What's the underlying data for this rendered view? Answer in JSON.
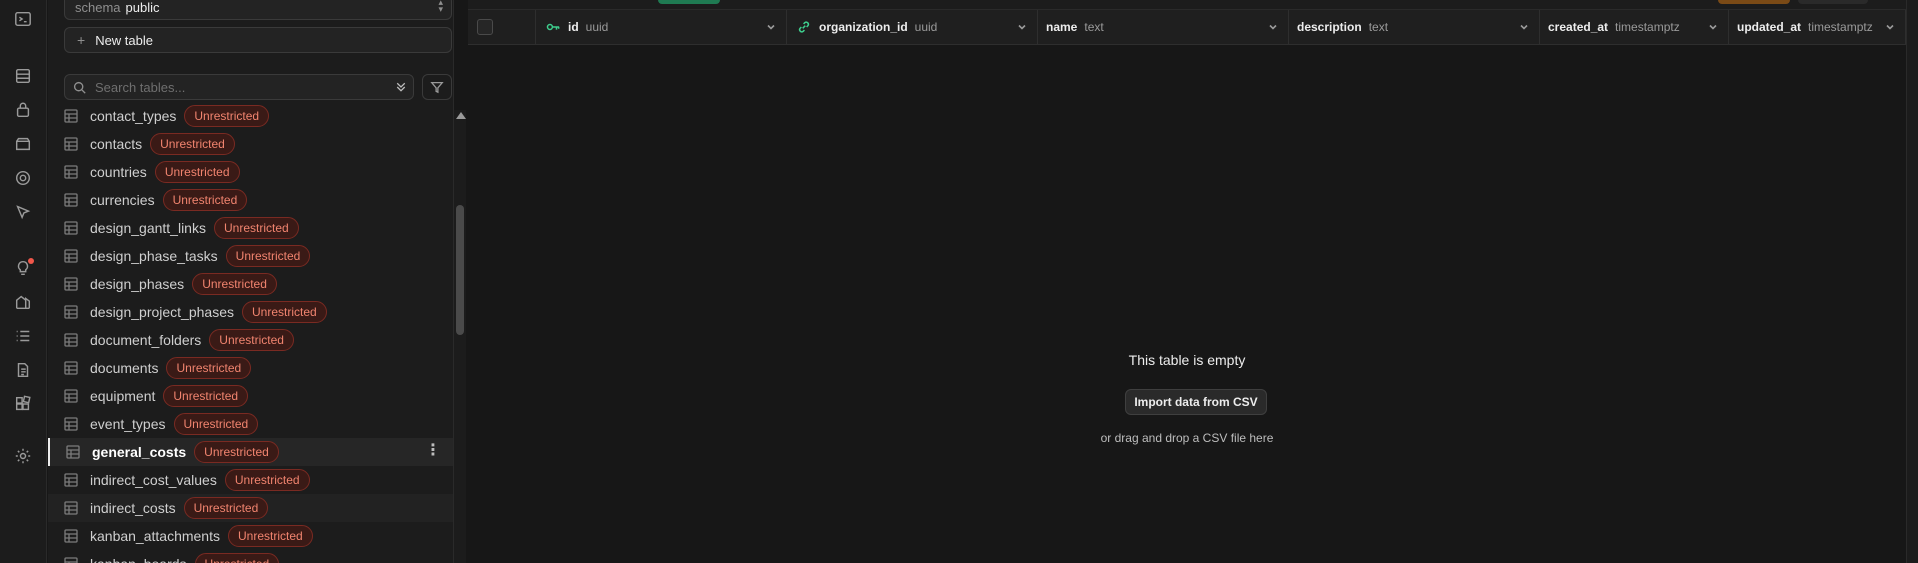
{
  "schema": {
    "label": "schema",
    "value": "public"
  },
  "new_table_label": "New table",
  "search": {
    "placeholder": "Search tables..."
  },
  "tables": [
    {
      "name": "contact_types",
      "badge": "Unrestricted"
    },
    {
      "name": "contacts",
      "badge": "Unrestricted"
    },
    {
      "name": "countries",
      "badge": "Unrestricted"
    },
    {
      "name": "currencies",
      "badge": "Unrestricted"
    },
    {
      "name": "design_gantt_links",
      "badge": "Unrestricted"
    },
    {
      "name": "design_phase_tasks",
      "badge": "Unrestricted"
    },
    {
      "name": "design_phases",
      "badge": "Unrestricted"
    },
    {
      "name": "design_project_phases",
      "badge": "Unrestricted"
    },
    {
      "name": "document_folders",
      "badge": "Unrestricted"
    },
    {
      "name": "documents",
      "badge": "Unrestricted"
    },
    {
      "name": "equipment",
      "badge": "Unrestricted"
    },
    {
      "name": "event_types",
      "badge": "Unrestricted"
    },
    {
      "name": "general_costs",
      "badge": "Unrestricted",
      "active": true
    },
    {
      "name": "indirect_cost_values",
      "badge": "Unrestricted"
    },
    {
      "name": "indirect_costs",
      "badge": "Unrestricted",
      "hover": true
    },
    {
      "name": "kanban_attachments",
      "badge": "Unrestricted"
    },
    {
      "name": "kanban_boards",
      "badge": "Unrestricted"
    }
  ],
  "columns": [
    {
      "name": "id",
      "type": "uuid",
      "icon": "key-icon"
    },
    {
      "name": "organization_id",
      "type": "uuid",
      "icon": "link-icon"
    },
    {
      "name": "name",
      "type": "text"
    },
    {
      "name": "description",
      "type": "text"
    },
    {
      "name": "created_at",
      "type": "timestamptz"
    },
    {
      "name": "updated_at",
      "type": "timestamptz"
    }
  ],
  "empty_state": {
    "title": "This table is empty",
    "import_button": "Import data from CSV",
    "subtitle": "or drag and drop a CSV file here"
  },
  "colors": {
    "accent_green": "#3ecf8e",
    "danger_badge": "#f1846f",
    "background": "#171717"
  }
}
